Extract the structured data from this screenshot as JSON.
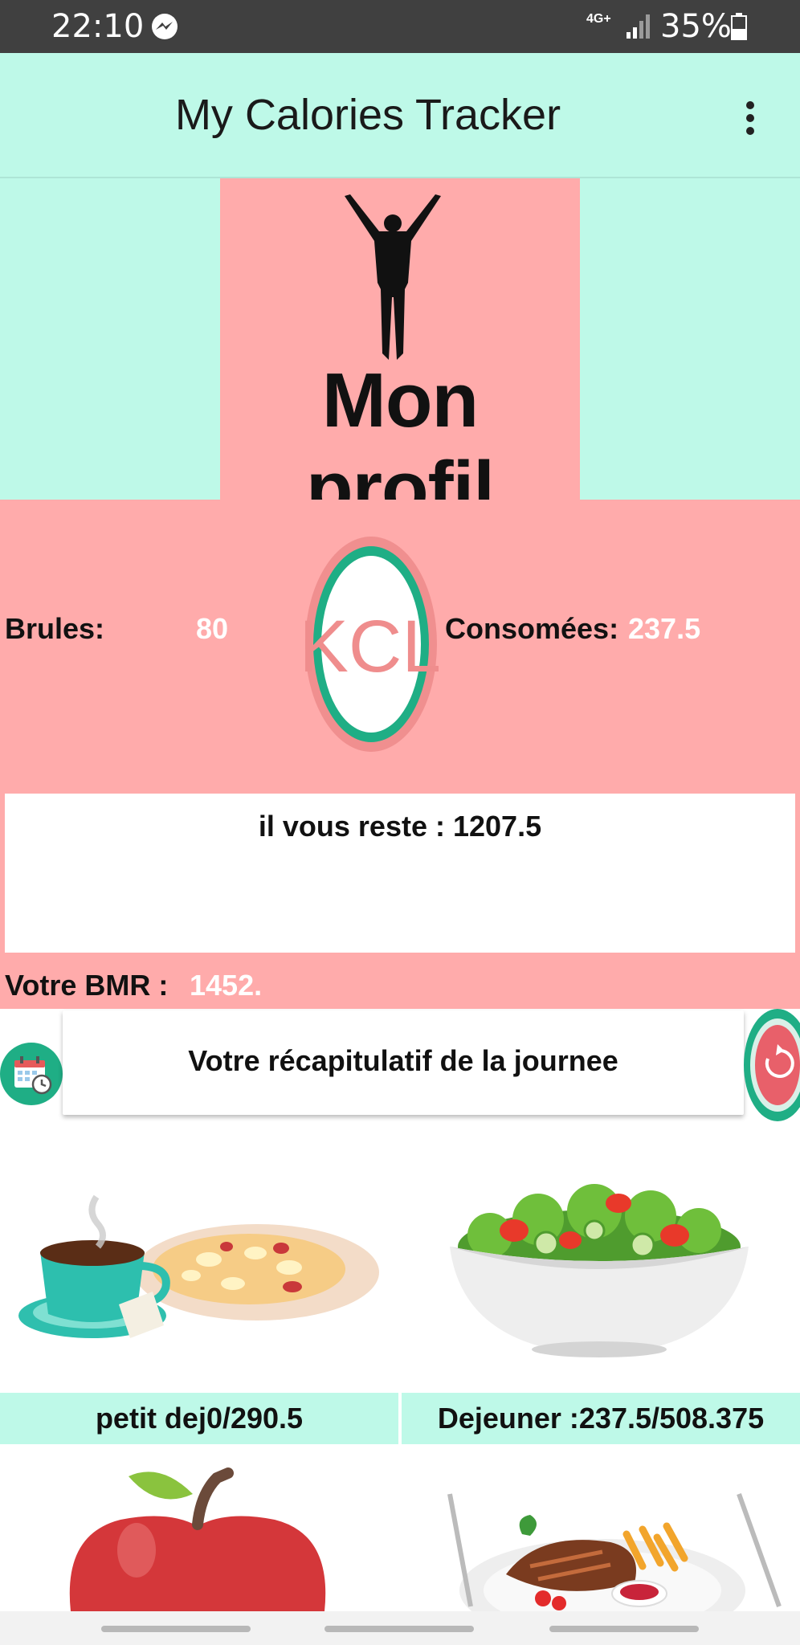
{
  "status_bar": {
    "time": "22:10",
    "network": "4G+",
    "battery": "35%",
    "icons": [
      "messenger-icon",
      "signal-icon",
      "battery-icon"
    ]
  },
  "app_bar": {
    "title": "My Calories Tracker",
    "menu_icon": "more-vert-icon"
  },
  "profile": {
    "title": "Mon profil",
    "figure_icon": "person-raised-arms-icon"
  },
  "stats": {
    "burned_label": "Brules:",
    "burned_value": "80",
    "badge_text": "KCL",
    "consumed_label": "Consomées:",
    "consumed_value": "237.5",
    "remaining_text": "il vous reste : 1207.5",
    "bmr_label": "Votre BMR :",
    "bmr_value": "1452."
  },
  "summary": {
    "title": "Votre récapitulatif de la journee",
    "calendar_icon": "calendar-clock-icon",
    "reset_icon": "refresh-icon"
  },
  "meals": [
    {
      "label": "petit dej0/290.5",
      "image": "breakfast-coffee-pasta-illustration"
    },
    {
      "label": "Dejeuner :237.5/508.375",
      "image": "salad-bowl-illustration"
    },
    {
      "label": "",
      "image": "apple-illustration"
    },
    {
      "label": "",
      "image": "steak-fries-plate-illustration"
    }
  ],
  "colors": {
    "mint": "#bef9e8",
    "pink": "#ffabab",
    "teal": "#1fae85",
    "status_bar": "#404040"
  }
}
